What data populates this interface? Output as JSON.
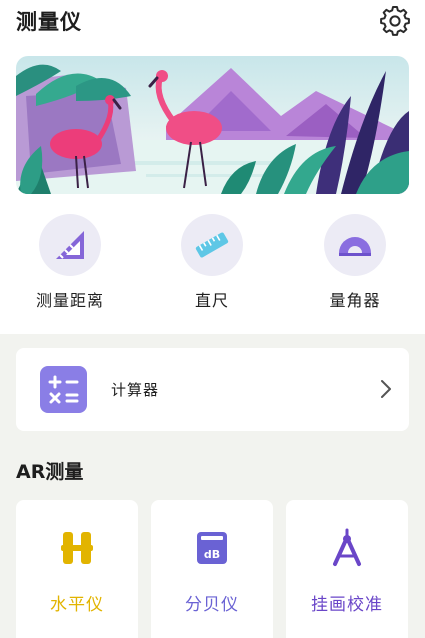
{
  "header": {
    "title": "测量仪",
    "settings_icon": "gear-icon"
  },
  "banner": {
    "illustration": "flamingo-landscape"
  },
  "tools": [
    {
      "label": "测量距离",
      "icon": "triangle-ruler-icon"
    },
    {
      "label": "直尺",
      "icon": "ruler-icon"
    },
    {
      "label": "量角器",
      "icon": "protractor-icon"
    }
  ],
  "calculator": {
    "label": "计算器",
    "icon": "calculator-icon",
    "chevron_icon": "chevron-right-icon"
  },
  "ar_section": {
    "title": "AR测量",
    "items": [
      {
        "label": "水平仪",
        "icon": "level-icon",
        "color": "#e2b400"
      },
      {
        "label": "分贝仪",
        "icon": "decibel-icon",
        "color": "#6a62d4"
      },
      {
        "label": "挂画校准",
        "icon": "compass-icon",
        "color": "#6a46c8"
      }
    ]
  },
  "colors": {
    "accent": "#7f6fe0",
    "background": "#f2f3ef",
    "icon_circle": "#ecebf5"
  }
}
